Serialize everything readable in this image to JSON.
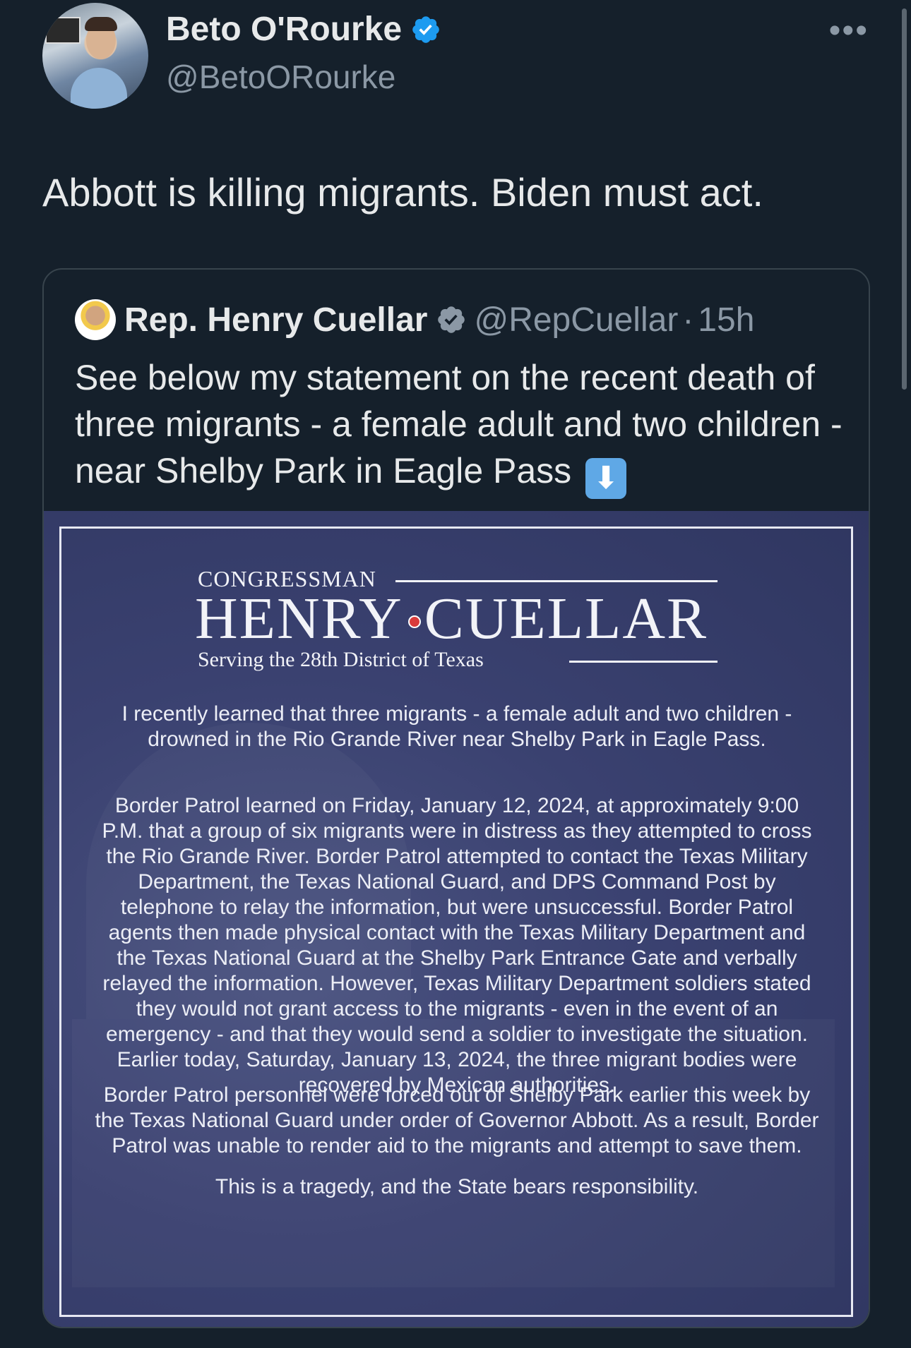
{
  "author": {
    "name": "Beto O'Rourke",
    "handle": "@BetoORourke",
    "more_label": "•••"
  },
  "tweet": {
    "text": "Abbott is killing migrants. Biden must act."
  },
  "quoted": {
    "name": "Rep. Henry Cuellar",
    "handle": "@RepCuellar",
    "separator": "·",
    "time": "15h",
    "text": "See below my statement on the recent death of three migrants - a female adult and two children - near Shelby Park in Eagle Pass",
    "emoji": "⬇"
  },
  "statement": {
    "logo_line1": "CONGRESSMAN",
    "logo_name_left": "HENRY",
    "logo_name_right": "CUELLAR",
    "logo_line3": "Serving the 28th District of Texas",
    "paragraph1": "I recently learned that three migrants - a female adult and two children - drowned in the Rio Grande River near Shelby Park in Eagle Pass.",
    "paragraph2": "Border Patrol learned on Friday, January 12, 2024, at approximately 9:00 P.M. that a group of six migrants were in distress as they attempted to cross the Rio Grande River. Border Patrol attempted to contact the Texas Military Department, the Texas National Guard, and DPS Command Post by telephone to relay the information, but were unsuccessful. Border Patrol agents then made physical contact with the Texas Military Department and the Texas National Guard at the Shelby Park Entrance Gate and verbally relayed the information. However, Texas Military Department soldiers stated they would not grant access to the migrants - even in the event of an emergency - and that they would send a soldier to investigate the situation. Earlier today, Saturday, January 13, 2024, the three migrant bodies were recovered by Mexican authorities.",
    "paragraph3": "Border Patrol personnel were forced out of Shelby Park earlier this week by the Texas National Guard under order of Governor Abbott. As a result, Border Patrol was unable to render aid to the migrants and attempt to save them.",
    "paragraph4": "This is a tragedy, and the State bears responsibility."
  },
  "colors": {
    "background": "#15202b",
    "verified_blue": "#1d9bf0",
    "verified_gray": "#8b98a5",
    "statement_navy": "#3a4170"
  }
}
